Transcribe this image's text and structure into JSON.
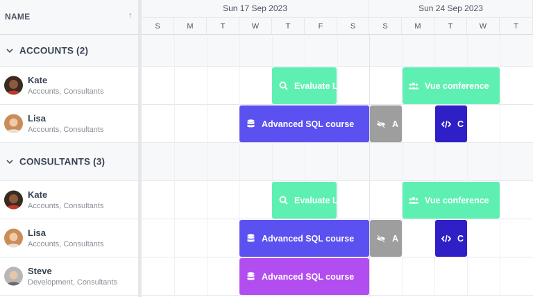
{
  "grid": {
    "column_name": "NAME"
  },
  "timeline": {
    "weeks": [
      "Sun 17 Sep 2023",
      "Sun 24 Sep 2023"
    ],
    "days": [
      "S",
      "M",
      "T",
      "W",
      "T",
      "F",
      "S",
      "S",
      "M",
      "T",
      "W",
      "T"
    ]
  },
  "groups": [
    {
      "label": "ACCOUNTS (2)",
      "resources": [
        {
          "name": "Kate",
          "sub": "Accounts, Consultants"
        },
        {
          "name": "Lisa",
          "sub": "Accounts, Consultants"
        }
      ]
    },
    {
      "label": "CONSULTANTS (3)",
      "resources": [
        {
          "name": "Kate",
          "sub": "Accounts, Consultants"
        },
        {
          "name": "Lisa",
          "sub": "Accounts, Consultants"
        },
        {
          "name": "Steve",
          "sub": "Development, Consultants"
        }
      ]
    }
  ],
  "events": {
    "evaluate": "Evaluate L",
    "vue": "Vue conference",
    "sql": "Advanced SQL course",
    "a": "A",
    "c": "C"
  },
  "colors": {
    "green": "#5ef0b3",
    "indigo": "#5b50f0",
    "gray": "#9e9e9e",
    "navy": "#2f1fc7",
    "purple": "#b24df0"
  }
}
